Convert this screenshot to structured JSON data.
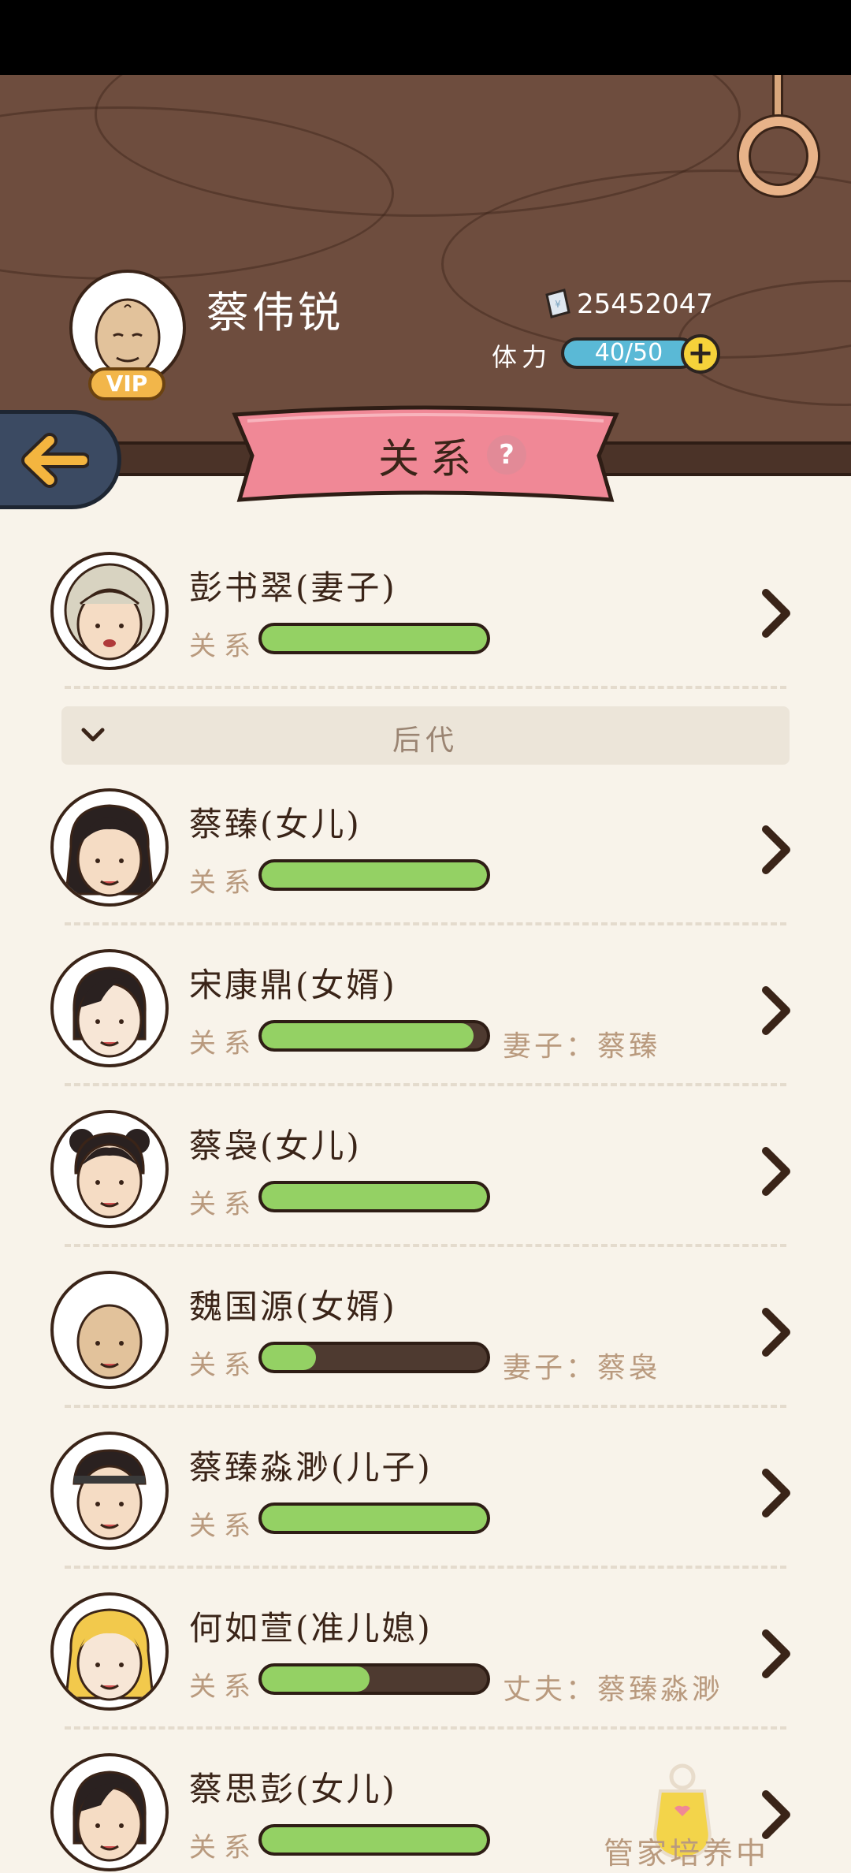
{
  "header": {
    "player_name": "蔡伟锐",
    "vip_label": "VIP",
    "currency_icon": "ticket-icon",
    "currency_value": "25452047",
    "stamina_label": "体力",
    "stamina_value": "40/50",
    "stamina_plus": "+"
  },
  "banner": {
    "title": "关系",
    "help": "?"
  },
  "spouse": {
    "name": "彭书翠(妻子)",
    "relation_label": "关系",
    "relation_level": 1.0
  },
  "section": {
    "label": "后代"
  },
  "descendants": [
    {
      "name": "蔡臻(女儿)",
      "relation_label": "关系",
      "relation_level": 1.0,
      "partner": ""
    },
    {
      "name": "宋康鼎(女婿)",
      "relation_label": "关系",
      "relation_level": 0.94,
      "partner": "妻子：蔡臻"
    },
    {
      "name": "蔡袅(女儿)",
      "relation_label": "关系",
      "relation_level": 1.0,
      "partner": ""
    },
    {
      "name": "魏国源(女婿)",
      "relation_label": "关系",
      "relation_level": 0.24,
      "partner": "妻子：蔡袅"
    },
    {
      "name": "蔡臻淼渺(儿子)",
      "relation_label": "关系",
      "relation_level": 1.0,
      "partner": ""
    },
    {
      "name": "何如萱(准儿媳)",
      "relation_label": "关系",
      "relation_level": 0.48,
      "partner": "丈夫：蔡臻淼渺"
    },
    {
      "name": "蔡思彭(女儿)",
      "relation_label": "关系",
      "relation_level": 1.0,
      "partner": ""
    }
  ],
  "butler": {
    "label": "管家培养中",
    "icon": "apron-icon"
  },
  "colors": {
    "wood": "#6e4d3e",
    "banner_pink": "#f08896",
    "bar_green": "#94d164",
    "stamina_blue": "#5ab9d6",
    "back_button": "#3b4a62"
  }
}
